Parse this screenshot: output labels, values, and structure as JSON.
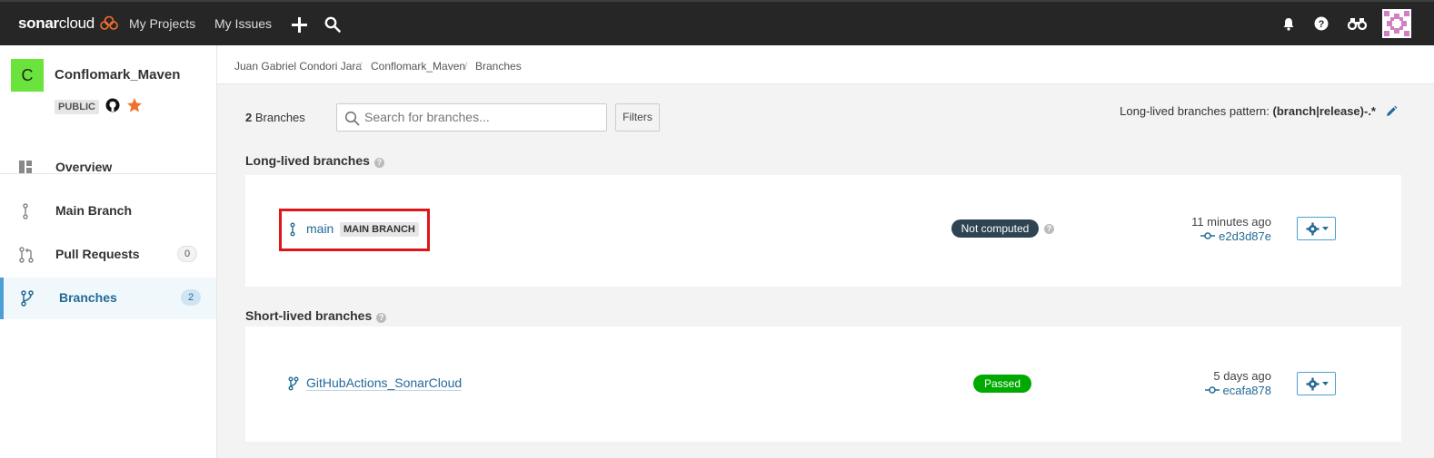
{
  "topnav": {
    "logo_bold": "sonar",
    "logo_light": "cloud",
    "my_projects": "My Projects",
    "my_issues": "My Issues"
  },
  "project": {
    "avatar_letter": "C",
    "name": "Conflomark_Maven",
    "visibility": "PUBLIC"
  },
  "sidebar": {
    "items": [
      {
        "label": "Overview",
        "icon": "dashboard-icon"
      },
      {
        "label": "Main Branch",
        "icon": "branch-icon"
      },
      {
        "label": "Pull Requests",
        "icon": "pull-request-icon",
        "count": "0"
      },
      {
        "label": "Branches",
        "icon": "fork-icon",
        "count": "2"
      }
    ]
  },
  "breadcrumb": [
    "Juan Gabriel Condori Jara",
    "Conflomark_Maven",
    "Branches"
  ],
  "toolbar": {
    "count_num": "2",
    "count_label": "Branches",
    "search_placeholder": "Search for branches...",
    "filters_label": "Filters",
    "pattern_label": "Long-lived branches pattern:",
    "pattern_value": "(branch|release)-.*"
  },
  "long_lived": {
    "title": "Long-lived branches",
    "branches": [
      {
        "name": "main",
        "badge": "MAIN BRANCH",
        "status": "Not computed",
        "time": "11 minutes ago",
        "commit": "e2d3d87e"
      }
    ]
  },
  "short_lived": {
    "title": "Short-lived branches",
    "branches": [
      {
        "name": "GitHubActions_SonarCloud",
        "status": "Passed",
        "time": "5 days ago",
        "commit": "ecafa878"
      }
    ]
  },
  "colors": {
    "topbar": "#262626",
    "link": "#236a97",
    "accent": "#4b9fd5",
    "passed": "#00aa00",
    "not_computed": "#2e4453",
    "highlight": "#e0151a"
  }
}
